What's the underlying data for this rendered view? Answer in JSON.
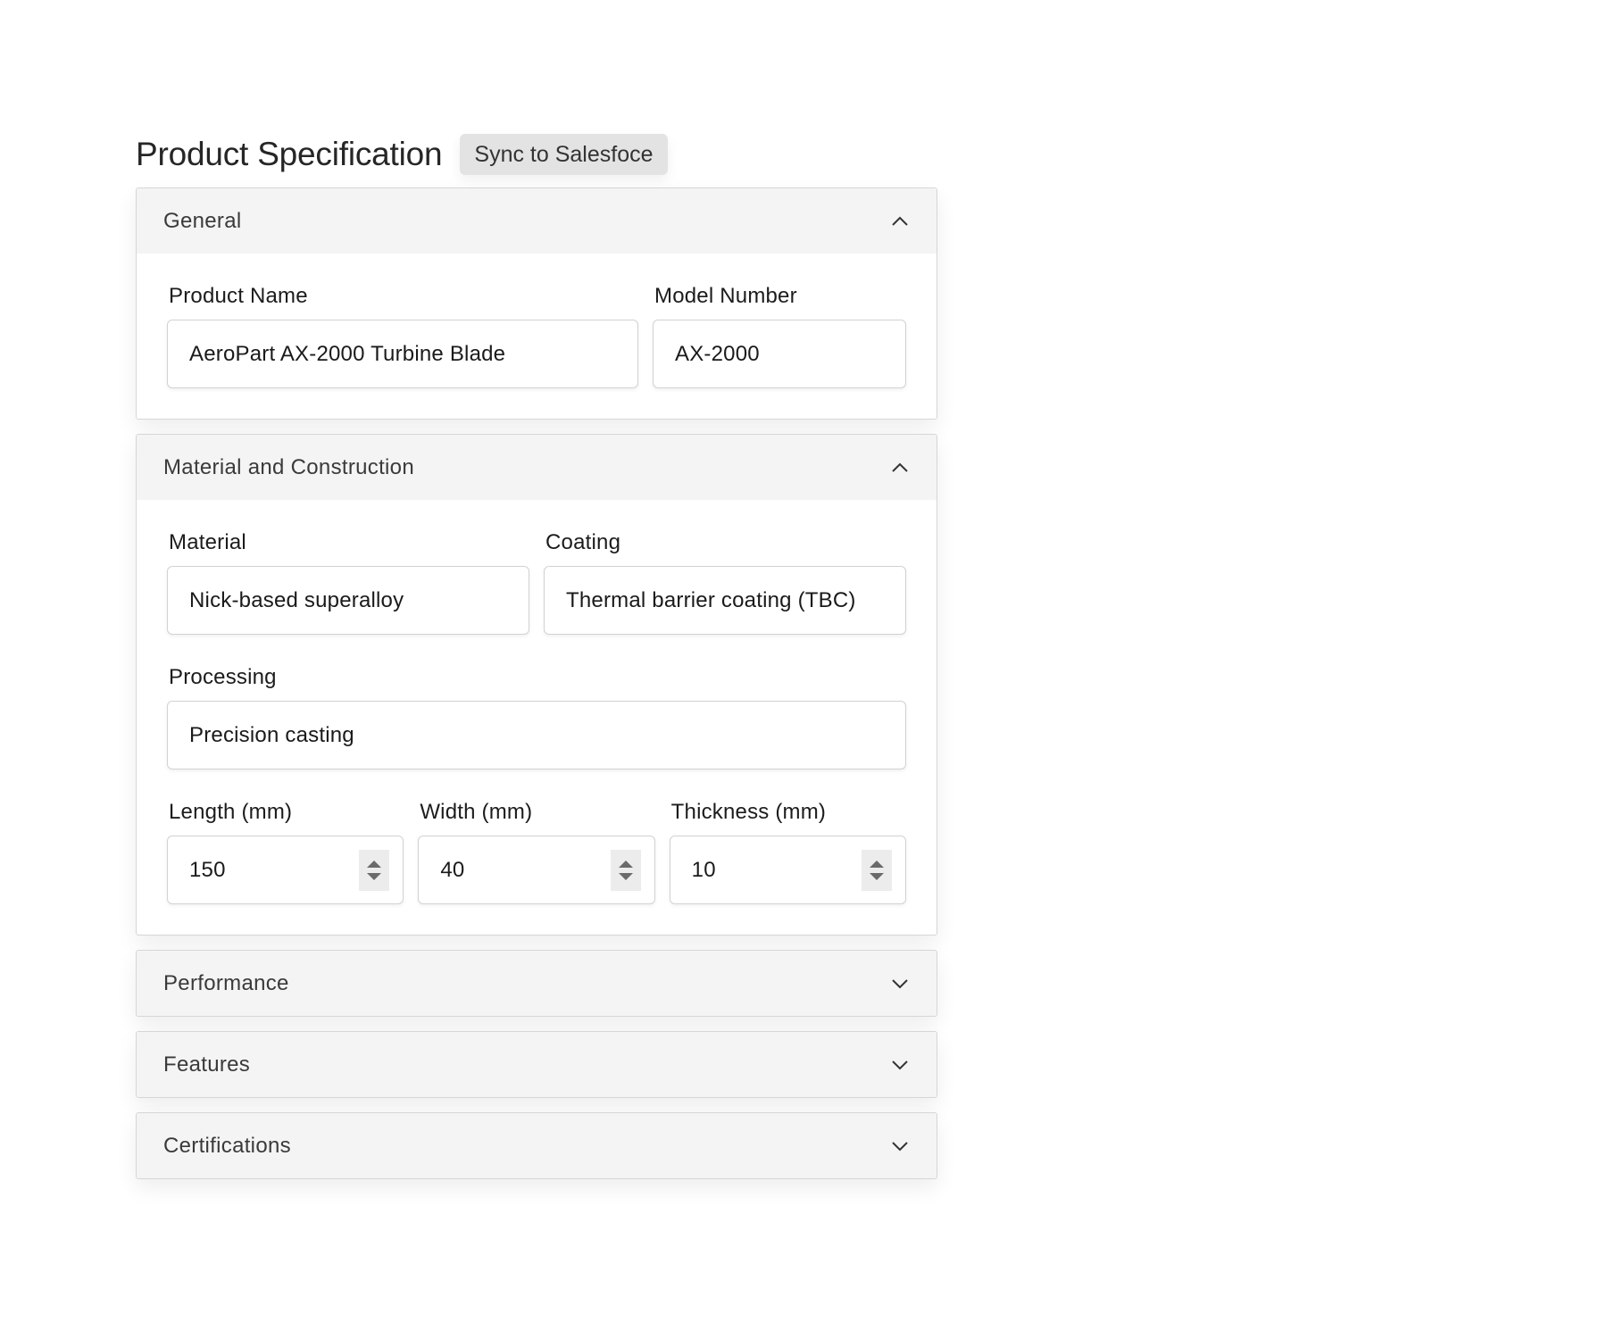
{
  "header": {
    "title": "Product Specification",
    "sync_button_label": "Sync to Salesfoce"
  },
  "sections": [
    {
      "title": "General",
      "expanded": true,
      "chevron_icon": "chevron-up-icon",
      "fields": {
        "product_name": {
          "label": "Product Name",
          "value": "AeroPart AX-2000 Turbine Blade"
        },
        "model_number": {
          "label": "Model Number",
          "value": "AX-2000"
        }
      }
    },
    {
      "title": "Material and Construction",
      "expanded": true,
      "chevron_icon": "chevron-up-icon",
      "fields": {
        "material": {
          "label": "Material",
          "value": "Nick-based superalloy"
        },
        "coating": {
          "label": "Coating",
          "value": "Thermal barrier coating (TBC)"
        },
        "processing": {
          "label": "Processing",
          "value": "Precision casting"
        },
        "length": {
          "label": "Length (mm)",
          "value": "150"
        },
        "width": {
          "label": "Width (mm)",
          "value": "40"
        },
        "thickness": {
          "label": "Thickness (mm)",
          "value": "10"
        }
      }
    },
    {
      "title": "Performance",
      "expanded": false,
      "chevron_icon": "chevron-down-icon"
    },
    {
      "title": "Features",
      "expanded": false,
      "chevron_icon": "chevron-down-icon"
    },
    {
      "title": "Certifications",
      "expanded": false,
      "chevron_icon": "chevron-down-icon"
    }
  ],
  "colors": {
    "header_bg": "#f4f4f4",
    "button_bg": "#e3e3e3",
    "border": "#d6d6d6",
    "text": "#222222"
  }
}
